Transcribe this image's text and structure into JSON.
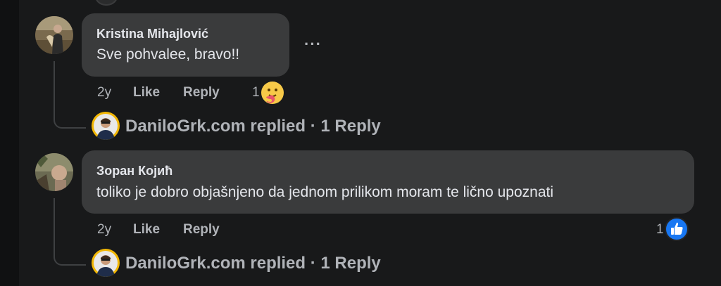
{
  "comments": [
    {
      "author": "Kristina Mihajlović",
      "text": "Sve pohvalee, bravo!!",
      "time": "2y",
      "like_label": "Like",
      "reply_label": "Reply",
      "more_label": "···",
      "reaction": {
        "type": "care",
        "count": "1"
      },
      "replies_link": "DaniloGrk.com replied · 1 Reply"
    },
    {
      "author": "Зоран Којић",
      "text": "toliko je dobro objašnjeno da jednom prilikom moram te lično upoznati",
      "time": "2y",
      "like_label": "Like",
      "reply_label": "Reply",
      "reaction": {
        "type": "like",
        "count": "1"
      },
      "replies_link": "DaniloGrk.com replied · 1 Reply"
    }
  ],
  "colors": {
    "background": "#18191a",
    "bubble": "#3a3b3c",
    "primary_text": "#e4e6eb",
    "secondary_text": "#b0b3b8",
    "like_blue": "#1877f2"
  }
}
